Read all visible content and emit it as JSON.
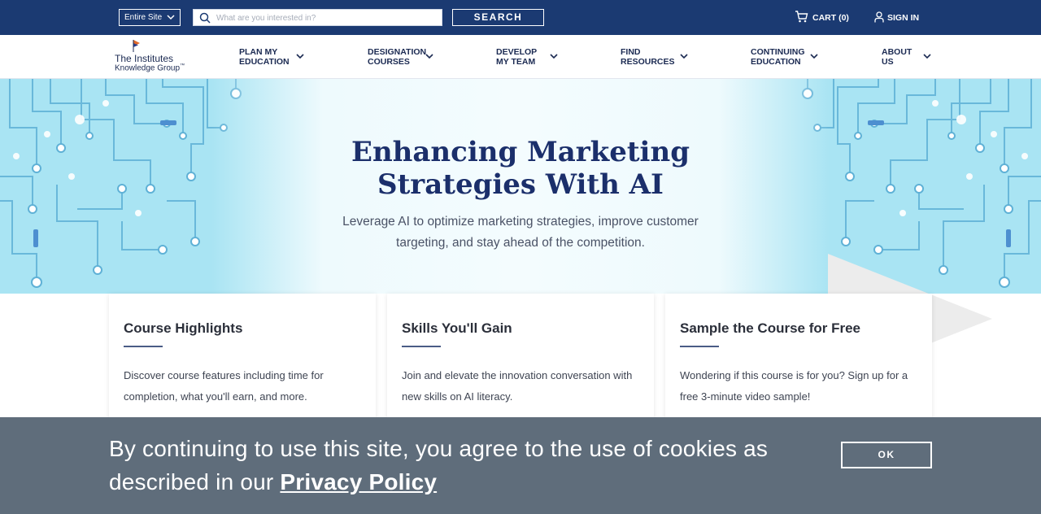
{
  "topbar": {
    "scope": "Entire Site",
    "search_placeholder": "What are you interested in?",
    "search_label": "SEARCH",
    "cart_label": "CART (0)",
    "signin_label": "SIGN IN"
  },
  "logo": {
    "line1": "The Institutes",
    "line2": "Knowledge Group",
    "tm": "™"
  },
  "nav": {
    "items": [
      {
        "label": "PLAN MY\nEDUCATION"
      },
      {
        "label": "DESIGNATION\nCOURSES"
      },
      {
        "label": "DEVELOP\nMY TEAM"
      },
      {
        "label": "FIND\nRESOURCES"
      },
      {
        "label": "CONTINUING\nEDUCATION"
      },
      {
        "label": "ABOUT\nUS"
      }
    ]
  },
  "hero": {
    "title": "Enhancing Marketing Strategies With AI",
    "subtitle": "Leverage AI to optimize marketing strategies, improve customer targeting, and stay ahead of the competition."
  },
  "cards": [
    {
      "title": "Course Highlights",
      "body": "Discover course features including time for completion, what you'll earn, and more."
    },
    {
      "title": "Skills You'll Gain",
      "body": "Join and elevate the innovation conversation with new skills on AI literacy."
    },
    {
      "title": "Sample the Course for Free",
      "body": "Wondering if this course is for you? Sign up for a free 3-minute video sample!"
    }
  ],
  "cookie": {
    "message": "By continuing to use this site, you agree to the use of cookies as described in our",
    "link": "Privacy Policy",
    "ok_label": "OK"
  },
  "colors": {
    "brand_navy": "#1b3a72",
    "hero_blue": "#a9e4f3",
    "title_navy": "#1b2f6b",
    "cookie_gray": "#5f6d7b"
  },
  "icons": [
    "chevron-down-icon",
    "search-icon",
    "cart-icon",
    "user-icon",
    "logo-flag-icon"
  ]
}
